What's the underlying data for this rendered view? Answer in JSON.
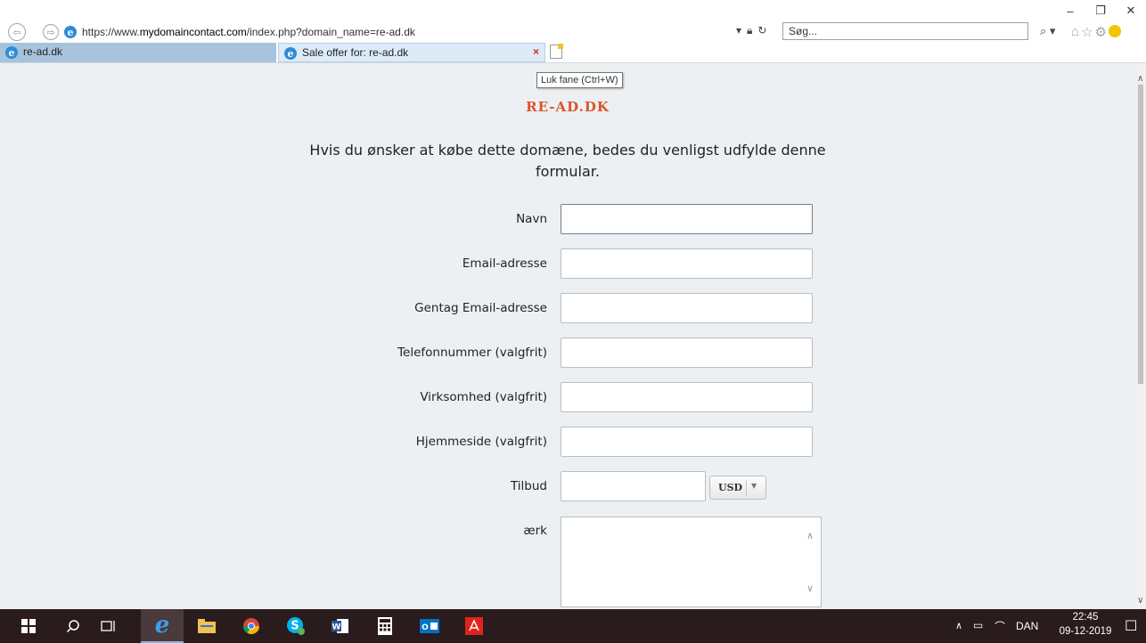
{
  "browser": {
    "url_prefix": "https://www.",
    "url_domain": "mydomaincontact.com",
    "url_path": "/index.php?domain_name=re-ad.dk",
    "search_placeholder": "Søg...",
    "tabs": [
      {
        "label": "re-ad.dk"
      },
      {
        "label": "Sale offer for: re-ad.dk"
      }
    ],
    "close_tab_glyph": "×",
    "tooltip": "Luk fane (Ctrl+W)"
  },
  "page": {
    "site_title": "RE-AD.DK",
    "intro": "Hvis du ønsker at købe dette domæne, bedes du venligst udfylde denne formular.",
    "fields": [
      {
        "label": "Navn"
      },
      {
        "label": "Email-adresse"
      },
      {
        "label": "Gentag Email-adresse"
      },
      {
        "label": "Telefonnummer (valgfrit)"
      },
      {
        "label": "Virksomhed (valgfrit)"
      },
      {
        "label": "Hjemmeside (valgfrit)"
      }
    ],
    "offer_label": "Tilbud",
    "currency": "USD",
    "remark_label": "ærk"
  },
  "taskbar": {
    "icons": [
      "windows-start-icon",
      "search-icon",
      "task-view-icon",
      "internet-explorer-icon",
      "file-explorer-icon",
      "chrome-icon",
      "skype-icon",
      "word-icon",
      "calculator-icon",
      "outlook-icon",
      "acrobat-icon"
    ],
    "language": "DAN",
    "time": "22:45",
    "date": "09-12-2019"
  },
  "colors": {
    "accent_title": "#d9552b",
    "content_bg": "#edf0f2",
    "taskbar_bg": "#2a1b1c",
    "tab_active_bg": "#dcebf7"
  }
}
